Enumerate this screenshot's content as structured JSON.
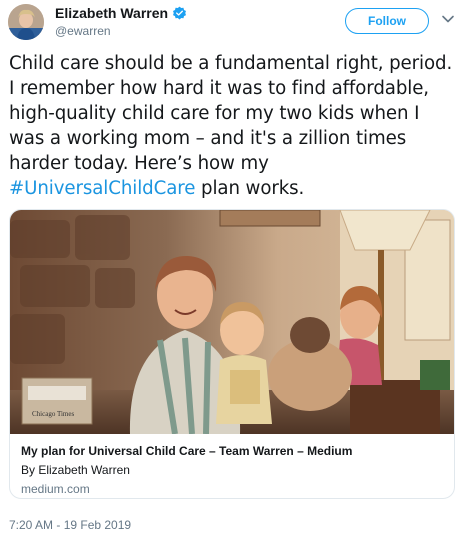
{
  "author": {
    "display_name": "Elizabeth Warren",
    "handle": "@ewarren",
    "verified": true
  },
  "follow_button": {
    "label": "Follow"
  },
  "tweet": {
    "text_before": "Child care should be a fundamental right, period. I remember how hard it was to find affordable, high-quality child care for my two kids when I was a working mom – and it's a zillion times harder today. Here’s how my ",
    "hashtag": "#UniversalChildCare",
    "text_after": " plan works.",
    "timestamp": "7:20 AM - 19 Feb 2019"
  },
  "card": {
    "title": "My plan for Universal Child Care – Team Warren – Medium",
    "byline": "By Elizabeth Warren",
    "domain": "medium.com",
    "image_caption_text": "Chicago Times"
  },
  "colors": {
    "link_blue": "#1b95e0",
    "follow_blue": "#1da1f2",
    "verified_blue": "#1da1f2",
    "secondary_text": "#657786"
  }
}
